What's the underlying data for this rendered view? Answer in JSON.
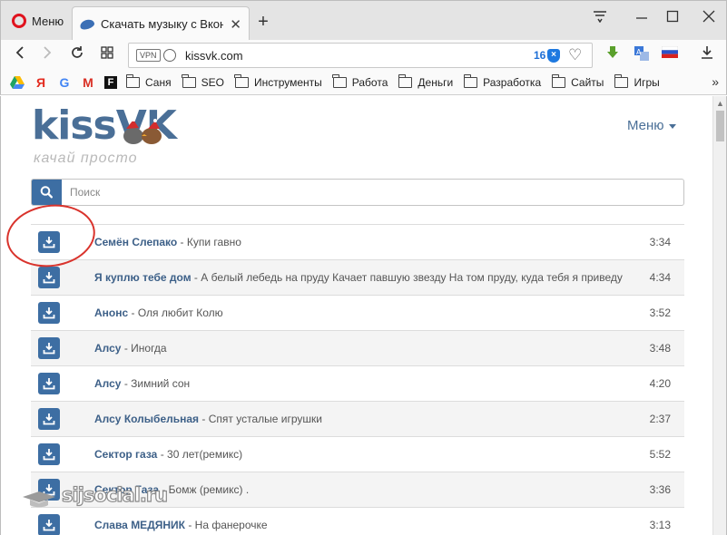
{
  "browser": {
    "menu_label": "Меню",
    "tab_title": "Скачать музыку с Вконта",
    "url": "kissvk.com",
    "vpn_badge": "VPN",
    "adblock_count": "16"
  },
  "bookmarks": {
    "icons": [
      "google-drive",
      "yandex",
      "google",
      "gmail",
      "f"
    ],
    "icon_glyphs": [
      "Я",
      "G",
      "M",
      "F"
    ],
    "folders": [
      "Саня",
      "SEO",
      "Инструменты",
      "Работа",
      "Деньги",
      "Разработка",
      "Сайты",
      "Игры"
    ]
  },
  "site": {
    "logo_kiss": "kiss",
    "logo_vk": "VK",
    "logo_tagline": "качай просто",
    "menu_label": "Меню",
    "search_placeholder": "Поиск",
    "accent_color": "#3d6ea3"
  },
  "tracks": [
    {
      "artist": "Семён Слепако",
      "title": " - Купи гавно",
      "duration": "3:34"
    },
    {
      "artist": "Я куплю тебе дом",
      "title": " - А белый лебедь на пруду Качает павшую звезду На том пруду, куда тебя я приведу",
      "duration": "4:34"
    },
    {
      "artist": "Анонс",
      "title": " - Оля любит Колю",
      "duration": "3:52"
    },
    {
      "artist": "Алсу",
      "title": " - Иногда",
      "duration": "3:48"
    },
    {
      "artist": "Алсу",
      "title": " - Зимний сон",
      "duration": "4:20"
    },
    {
      "artist": "Алсу Колыбельная",
      "title": " - Спят усталые игрушки",
      "duration": "2:37"
    },
    {
      "artist": "Сектор газа",
      "title": " - 30 лет(ремикс)",
      "duration": "5:52"
    },
    {
      "artist": "Сектор Газа",
      "title": " - Бомж (ремикс) .",
      "duration": "3:36"
    },
    {
      "artist": "Слава МЕДЯНИК",
      "title": " - На фанерочке",
      "duration": "3:13"
    }
  ],
  "watermark": "sijsocial.ru"
}
